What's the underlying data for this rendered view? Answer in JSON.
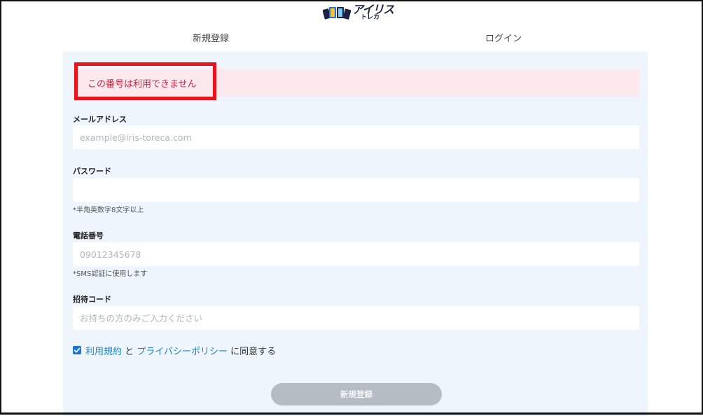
{
  "header": {
    "logo_main": "アイリス",
    "logo_sub": "トレカ"
  },
  "tabs": {
    "register": "新規登録",
    "login": "ログイン"
  },
  "error": {
    "message": "この番号は利用できません"
  },
  "form": {
    "email": {
      "label": "メールアドレス",
      "value": "",
      "placeholder": "example@iris-toreca.com"
    },
    "password": {
      "label": "パスワード",
      "value": "",
      "placeholder": "",
      "hint": "*半角英数字8文字以上"
    },
    "phone": {
      "label": "電話番号",
      "value": "",
      "placeholder": "09012345678",
      "hint": "*SMS認証に使用します"
    },
    "invite": {
      "label": "招待コード",
      "value": "",
      "placeholder": "お持ちの方のみご入力ください"
    },
    "agreement": {
      "checked": true,
      "terms_link": "利用規約",
      "connector": " と ",
      "privacy_link": "プライバシーポリシー",
      "suffix": " に同意する"
    },
    "submit_label": "新規登録"
  },
  "colors": {
    "panel_bg": "#eff5fd",
    "error_bg": "#fde8ee",
    "error_text": "#d0243e",
    "highlight_border": "#e8141a",
    "link": "#1d83c9",
    "checkbox": "#1a73d6",
    "button_disabled": "#b6bcc3"
  }
}
